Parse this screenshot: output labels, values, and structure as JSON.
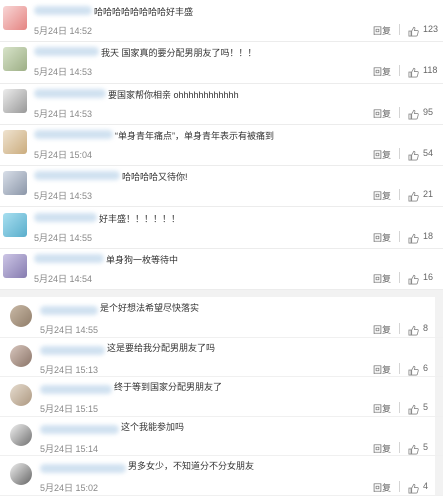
{
  "section1": {
    "comments": [
      {
        "text": "哈哈哈哈哈哈哈哈好丰盛",
        "date": "5月24日 14:52",
        "reply": "回复",
        "likes": "123",
        "bg": "#f8d6d6",
        "fg": "#d9534f"
      },
      {
        "text": "我天 国家真的要分配男朋友了吗！！！",
        "date": "5月24日 14:53",
        "reply": "回复",
        "likes": "118",
        "bg": "#d7e3c9",
        "fg": "#7a8f5d"
      },
      {
        "text": "要国家帮你相亲 ohhhhhhhhhhhh",
        "date": "5月24日 14:53",
        "reply": "回复",
        "likes": "95",
        "bg": "#ececec",
        "fg": "#666666"
      },
      {
        "text": "“单身青年痛点”，单身青年表示有被痛到",
        "date": "5月24日 15:04",
        "reply": "回复",
        "likes": "54",
        "bg": "#efe3d0",
        "fg": "#b58b4c"
      },
      {
        "text": "哈哈哈哈又待你!",
        "date": "5月24日 14:53",
        "reply": "回复",
        "likes": "21",
        "bg": "#d8dee8",
        "fg": "#5d6b82"
      },
      {
        "text": "好丰盛！！！！！！",
        "date": "5月24日 14:55",
        "reply": "回复",
        "likes": "18",
        "bg": "#a8dff0",
        "fg": "#2a8fb5"
      },
      {
        "text": "单身狗一枚等待中",
        "date": "5月24日 14:54",
        "reply": "回复",
        "likes": "16",
        "bg": "#cdc6e6",
        "fg": "#5b4f8f"
      }
    ]
  },
  "section2": {
    "comments": [
      {
        "text": "是个好想法希望尽快落实",
        "date": "5月24日 14:55",
        "reply": "回复",
        "likes": "8",
        "bg": "#c9b9a6",
        "fg": "#6d5844"
      },
      {
        "text": "这是要给我分配男朋友了吗",
        "date": "5月24日 15:13",
        "reply": "回复",
        "likes": "6",
        "bg": "#d8c6bd",
        "fg": "#5c4335"
      },
      {
        "text": "终于等到国家分配男朋友了",
        "date": "5月24日 15:15",
        "reply": "回复",
        "likes": "5",
        "bg": "#e6dccf",
        "fg": "#8a6f51"
      },
      {
        "text": "这个我能参加吗",
        "date": "5月24日 15:14",
        "reply": "回复",
        "likes": "5",
        "bg": "#f0f0f0",
        "fg": "#222222"
      },
      {
        "text": "男多女少，不知道分不分女朋友",
        "date": "5月24日 15:02",
        "reply": "回复",
        "likes": "4",
        "bg": "#eeeeee",
        "fg": "#111111"
      }
    ]
  }
}
